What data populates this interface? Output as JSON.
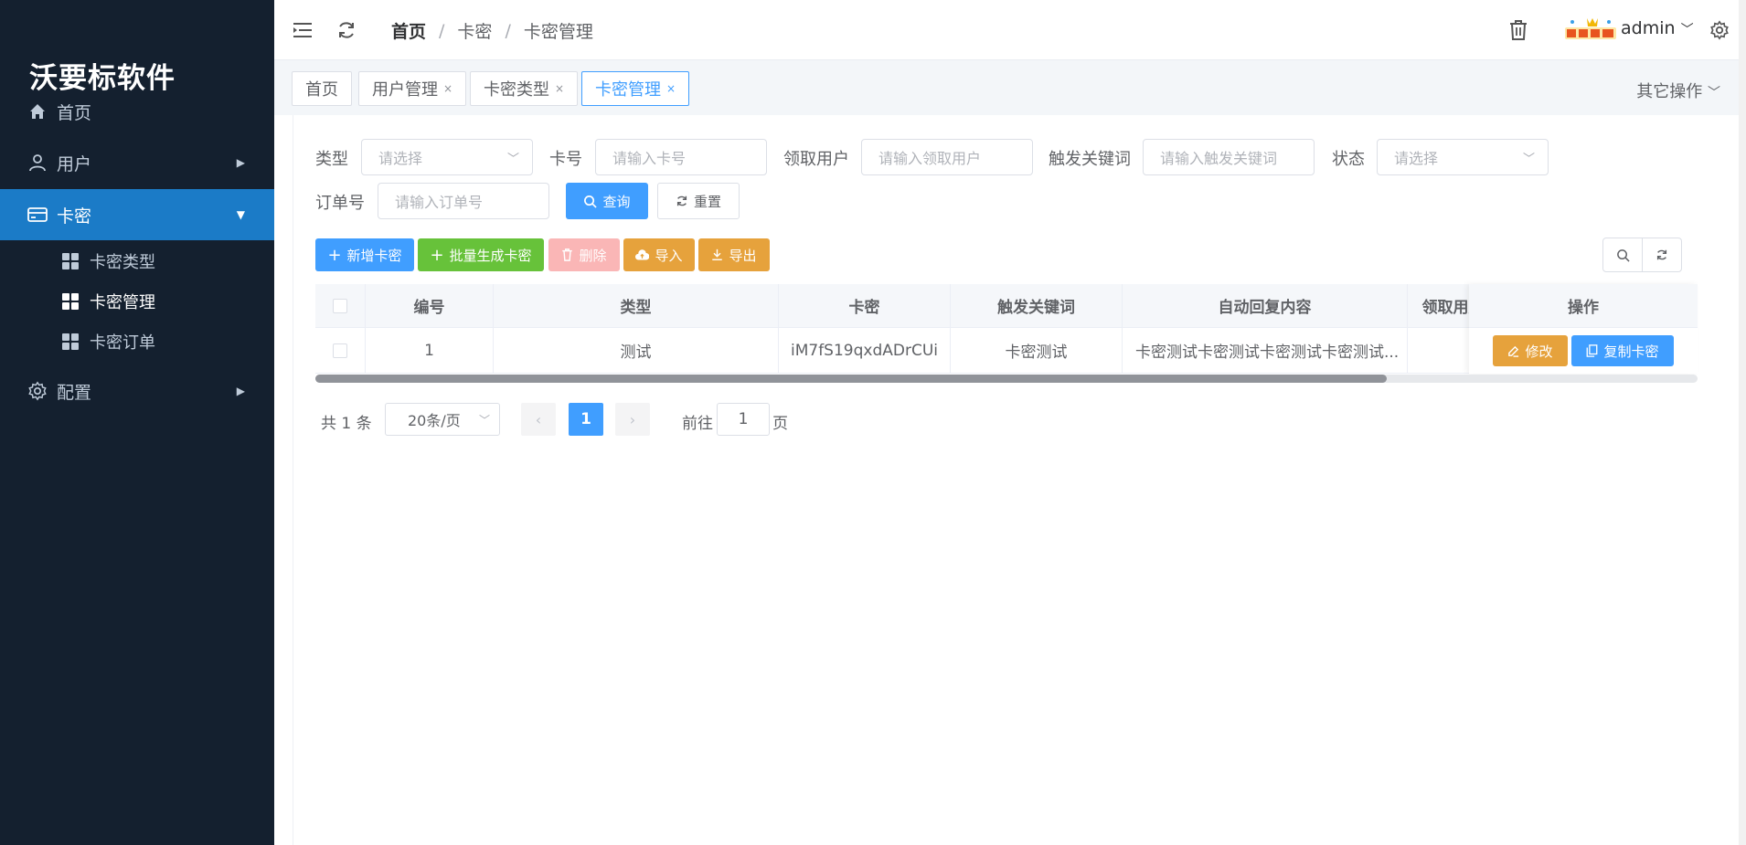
{
  "sidebar": {
    "brand": "沃要标软件",
    "menu": [
      {
        "label": "首页",
        "icon": "home-icon"
      },
      {
        "label": "用户",
        "icon": "user-icon"
      },
      {
        "label": "卡密",
        "icon": "card-icon"
      },
      {
        "label": "配置",
        "icon": "gear-icon"
      }
    ],
    "submenu": [
      {
        "label": "卡密类型"
      },
      {
        "label": "卡密管理"
      },
      {
        "label": "卡密订单"
      }
    ]
  },
  "header": {
    "breadcrumb": [
      "首页",
      "卡密",
      "卡密管理"
    ],
    "breadcrumb_sep": "/",
    "username": "admin"
  },
  "tags": [
    {
      "label": "首页"
    },
    {
      "label": "用户管理",
      "close": "×"
    },
    {
      "label": "卡密类型",
      "close": "×"
    },
    {
      "label": "卡密管理",
      "close": "×"
    }
  ],
  "other_ops": "其它操作",
  "filters": {
    "type": {
      "label": "类型",
      "placeholder": "请选择"
    },
    "card_no": {
      "label": "卡号",
      "placeholder": "请输入卡号"
    },
    "receiver": {
      "label": "领取用户",
      "placeholder": "请输入领取用户"
    },
    "keyword": {
      "label": "触发关键词",
      "placeholder": "请输入触发关键词"
    },
    "status": {
      "label": "状态",
      "placeholder": "请选择"
    },
    "order_no": {
      "label": "订单号",
      "placeholder": "请输入订单号"
    },
    "query_btn": "查询",
    "reset_btn": "重置"
  },
  "toolbar": {
    "add": "新增卡密",
    "batch": "批量生成卡密",
    "delete": "删除",
    "import": "导入",
    "export": "导出"
  },
  "table": {
    "columns": [
      "编号",
      "类型",
      "卡密",
      "触发关键词",
      "自动回复内容",
      "领取用户"
    ],
    "ops_header": "操作",
    "rows": [
      {
        "id": "1",
        "type": "测试",
        "card": "iM7fS19qxdADrCUi",
        "keyword": "卡密测试",
        "reply": "卡密测试卡密测试卡密测试卡密测试...",
        "receiver": ""
      }
    ],
    "edit_btn": "修改",
    "copy_btn": "复制卡密",
    "scroll_fraction": 0.775
  },
  "pagination": {
    "total": "共 1 条",
    "page_size": "20条/页",
    "current": "1",
    "goto_prefix": "前往",
    "goto_value": "1",
    "goto_suffix": "页"
  },
  "colors": {
    "sidebar_bg": "#14202f",
    "active_menu": "#1b7bc7",
    "primary": "#409eff",
    "success": "#67c23a",
    "warning": "#e6a23c",
    "danger_disabled": "#fab6b6"
  }
}
